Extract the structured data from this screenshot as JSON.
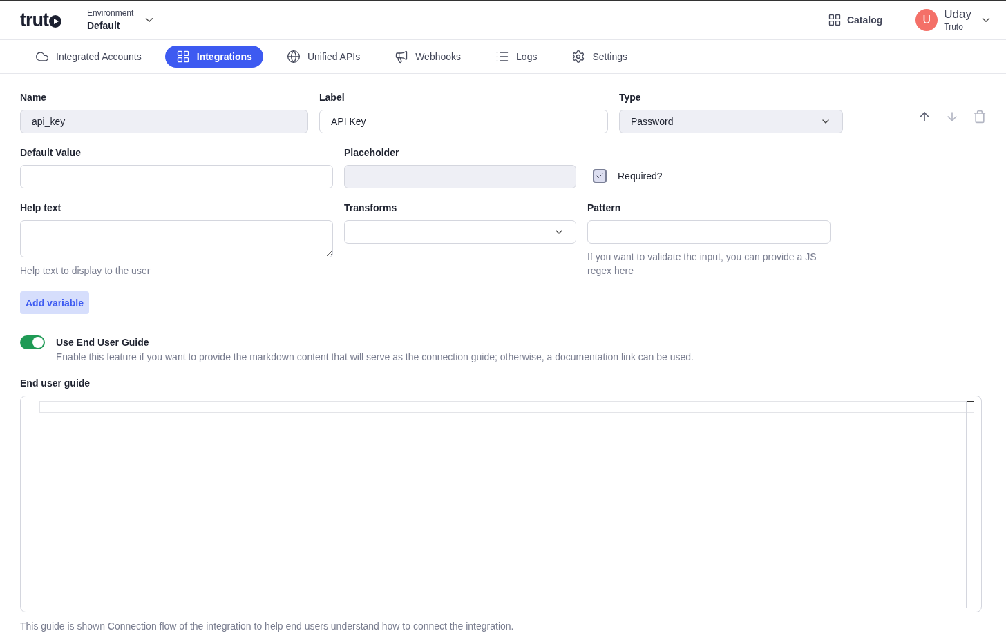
{
  "header": {
    "logo": "trut",
    "environment": {
      "label": "Environment",
      "value": "Default"
    },
    "catalog": "Catalog",
    "user": {
      "initial": "U",
      "name": "Uday",
      "org": "Truto"
    }
  },
  "tabs": [
    {
      "label": "Integrated Accounts",
      "selected": false
    },
    {
      "label": "Integrations",
      "selected": true
    },
    {
      "label": "Unified APIs",
      "selected": false
    },
    {
      "label": "Webhooks",
      "selected": false
    },
    {
      "label": "Logs",
      "selected": false
    },
    {
      "label": "Settings",
      "selected": false
    }
  ],
  "variable": {
    "name": {
      "label": "Name",
      "value": "api_key",
      "disabled": true
    },
    "label": {
      "label": "Label",
      "value": "API Key",
      "disabled": false
    },
    "type": {
      "label": "Type",
      "value": "Password"
    },
    "default_value": {
      "label": "Default Value"
    },
    "placeholder": {
      "label": "Placeholder",
      "disabled": true
    },
    "required": {
      "label": "Required?",
      "checked": true
    },
    "help_text": {
      "label": "Help text",
      "hint": "Help text to display to the user"
    },
    "transforms": {
      "label": "Transforms"
    },
    "pattern": {
      "label": "Pattern",
      "hint": "If you want to validate the input, you can provide a JS regex here"
    }
  },
  "add_variable": "Add variable",
  "end_user_guide_toggle": {
    "label": "Use End User Guide",
    "description": "Enable this feature if you want to provide the markdown content that will serve as the connection guide; otherwise, a documentation link can be used.",
    "on": true
  },
  "end_user_guide": {
    "label": "End user guide",
    "hint": "This guide is shown Connection flow of the integration to help end users understand how to connect the integration."
  }
}
